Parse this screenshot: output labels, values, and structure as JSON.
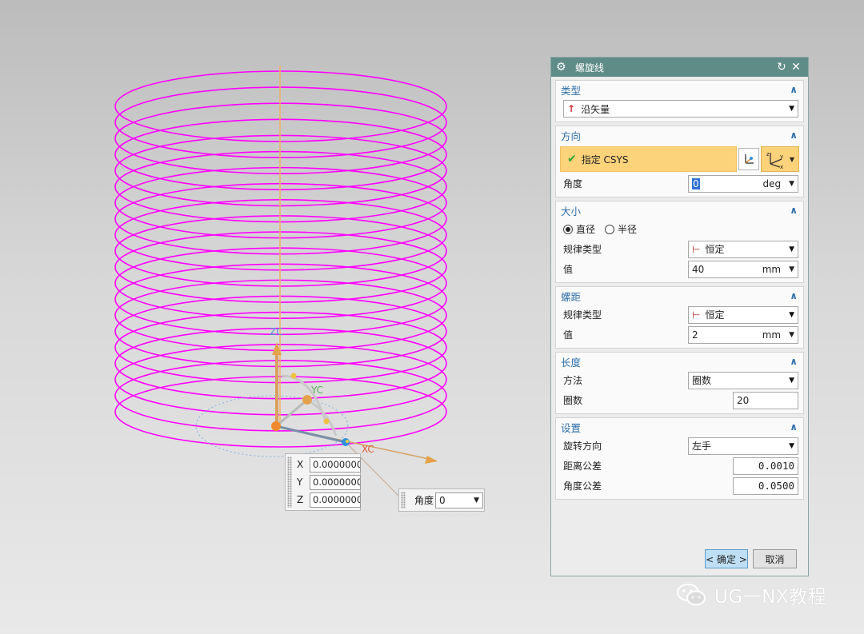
{
  "viewport": {
    "helix": {
      "turns": 20,
      "diameter": 40,
      "pitch": 2,
      "color": "#ff00ff"
    },
    "axis_labels": {
      "zc": "ZC",
      "yc": "YC",
      "xc": "XC"
    },
    "coords": {
      "x_label": "X",
      "x_value": "0.0000000",
      "y_label": "Y",
      "y_value": "0.0000000",
      "z_label": "Z",
      "z_value": "0.0000000"
    },
    "angle": {
      "label": "角度",
      "value": "0"
    }
  },
  "dialog": {
    "title": "螺旋线",
    "type_section": {
      "title": "类型",
      "value": "沿矢量"
    },
    "direction_section": {
      "title": "方向",
      "specify_csys": "指定 CSYS",
      "angle_label": "角度",
      "angle_value": "0",
      "angle_unit": "deg"
    },
    "size_section": {
      "title": "大小",
      "radio_diameter": "直径",
      "radio_radius": "半径",
      "law_label": "规律类型",
      "law_value": "恒定",
      "value_label": "值",
      "value": "40",
      "unit": "mm"
    },
    "pitch_section": {
      "title": "螺距",
      "law_label": "规律类型",
      "law_value": "恒定",
      "value_label": "值",
      "value": "2",
      "unit": "mm"
    },
    "length_section": {
      "title": "长度",
      "method_label": "方法",
      "method_value": "圈数",
      "turns_label": "圈数",
      "turns_value": "20"
    },
    "settings_section": {
      "title": "设置",
      "rotation_label": "旋转方向",
      "rotation_value": "左手",
      "dist_tol_label": "距离公差",
      "dist_tol_value": "0.0010",
      "angle_tol_label": "角度公差",
      "angle_tol_value": "0.0500"
    },
    "ok_label": "< 确定 >",
    "cancel_label": "取消"
  },
  "watermark": {
    "text": "UG一NX教程"
  },
  "colors": {
    "titlebar": "#5f8c87",
    "section_heading": "#2f6fa8",
    "selection": "#fcd27a",
    "helix": "#ff00ff"
  }
}
